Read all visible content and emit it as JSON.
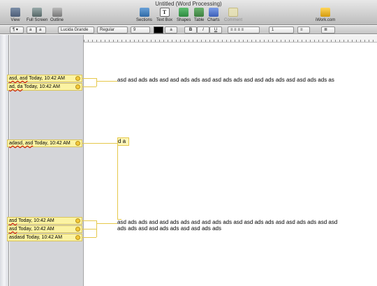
{
  "window": {
    "title": "Untitled (Word Processing)"
  },
  "toolbar": {
    "view": "View",
    "full_screen": "Full Screen",
    "outline": "Outline",
    "sections": "Sections",
    "text_box": "Text Box",
    "text_box_glyph": "T",
    "shapes": "Shapes",
    "table": "Table",
    "charts": "Charts",
    "comment": "Comment",
    "iwork": "iWork.com"
  },
  "format_bar": {
    "font_family": "Lucida Grande",
    "font_style": "Regular",
    "font_size": "9",
    "text_swatch": "a",
    "line_spacing": "1"
  },
  "comments": [
    {
      "author": "asd, asd",
      "time": "Today, 10:42 AM"
    },
    {
      "author": "ad, da",
      "time": "Today, 10:42 AM"
    },
    {
      "author": "adasd, asd",
      "time": "Today, 10:42 AM"
    },
    {
      "author": "asd",
      "time": "Today, 10:42 AM"
    },
    {
      "author": "asd",
      "time": "Today, 10:42 AM"
    },
    {
      "author": "asdasd",
      "time": "Today, 10:42 AM"
    }
  ],
  "document": {
    "line1": "asd asd ads ads asd asd ads ads asd asd ads ads asd asd ads ads asd asd ads ads as",
    "line2": "d a",
    "line3": "asd ads ads asd asd ads ads asd asd ads ads asd asd ads ads asd asd ads ads asd asd",
    "line4": "ads ads asd asd ads ads asd asd ads ads"
  }
}
